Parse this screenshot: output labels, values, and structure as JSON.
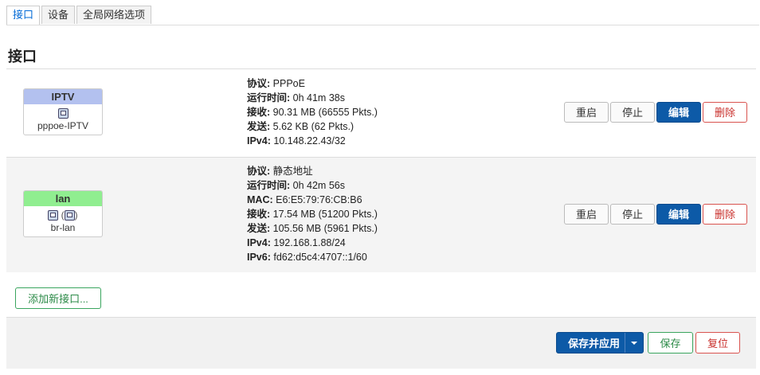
{
  "tabs": [
    "接口",
    "设备",
    "全局网络选项"
  ],
  "section_title": "接口",
  "interfaces": [
    {
      "name": "IPTV",
      "header_color": "#aebdf0",
      "device": "pppoe-IPTV",
      "info": [
        {
          "label": "协议:",
          "value": "PPPoE"
        },
        {
          "label": "运行时间:",
          "value": "0h 41m 38s"
        },
        {
          "label": "接收:",
          "value": "90.31 MB (66555 Pkts.)"
        },
        {
          "label": "发送:",
          "value": "5.62 KB (62 Pkts.)"
        },
        {
          "label": "IPv4:",
          "value": "10.148.22.43/32"
        }
      ]
    },
    {
      "name": "lan",
      "header_color": "#90ee90",
      "device_icons": "(",
      "device_icons_close": ")",
      "device": "br-lan",
      "info": [
        {
          "label": "协议:",
          "value": "静态地址"
        },
        {
          "label": "运行时间:",
          "value": "0h 42m 56s"
        },
        {
          "label": "MAC:",
          "value": "E6:E5:79:76:CB:B6"
        },
        {
          "label": "接收:",
          "value": "17.54 MB (51200 Pkts.)"
        },
        {
          "label": "发送:",
          "value": "105.56 MB (5961 Pkts.)"
        },
        {
          "label": "IPv4:",
          "value": "192.168.1.88/24"
        },
        {
          "label": "IPv6:",
          "value": "fd62:d5c4:4707::1/60"
        }
      ]
    }
  ],
  "row_buttons": {
    "restart": "重启",
    "stop": "停止",
    "edit": "编辑",
    "delete": "删除"
  },
  "add_interface": "添加新接口...",
  "footer": {
    "save_apply": "保存并应用",
    "save": "保存",
    "reset": "复位"
  }
}
